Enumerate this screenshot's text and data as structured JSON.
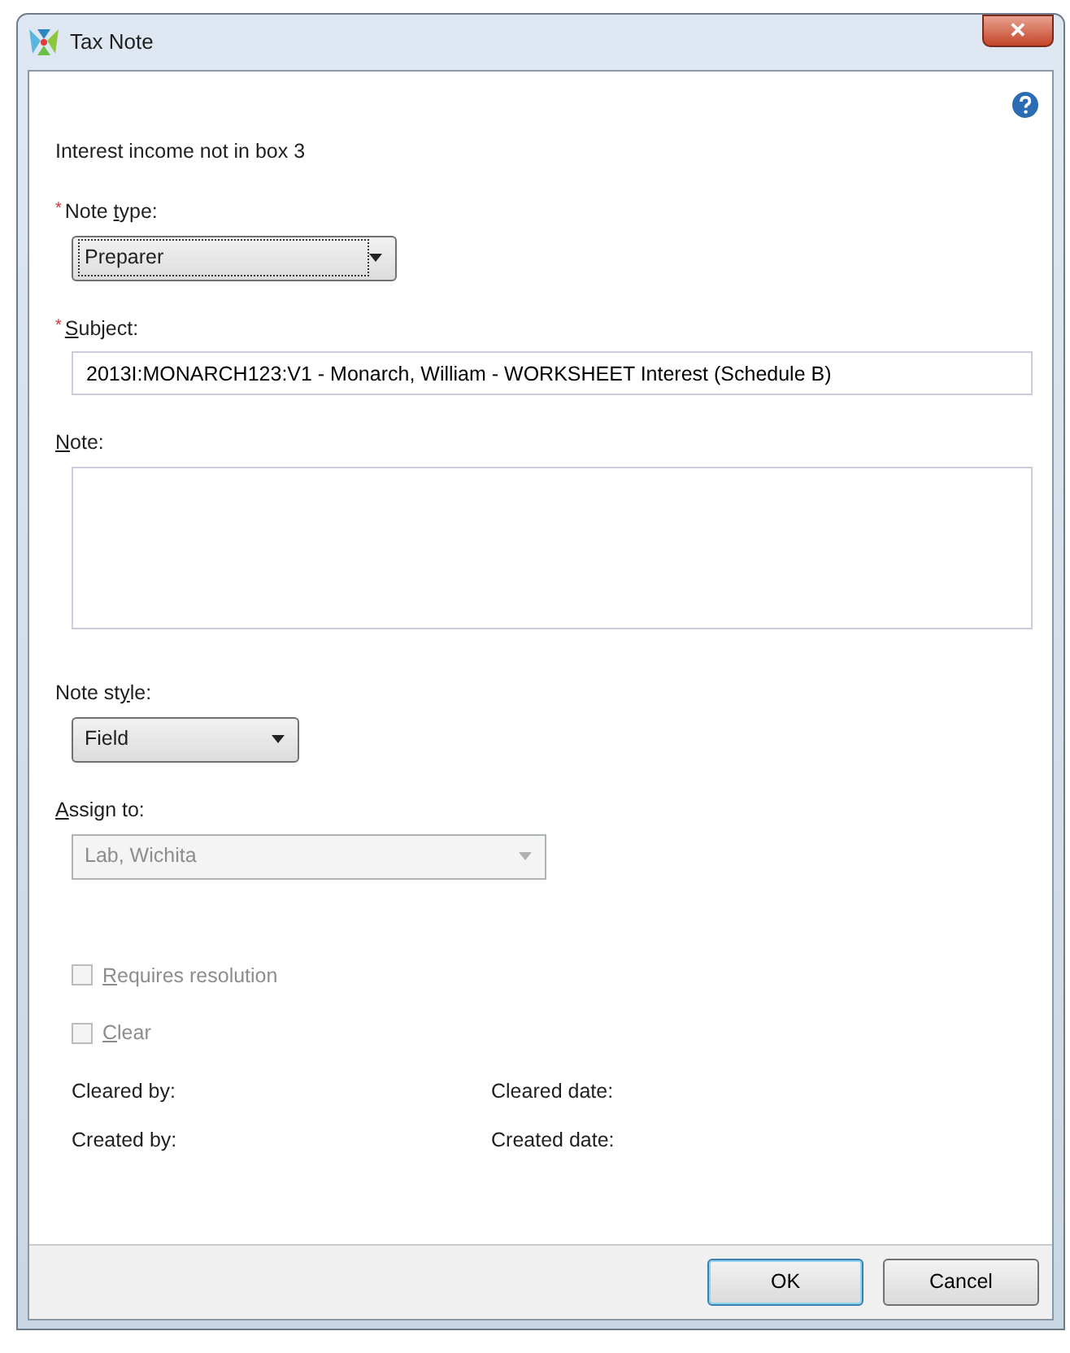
{
  "window": {
    "title": "Tax Note",
    "close_glyph": "✕"
  },
  "heading": "Interest income not in box 3",
  "fields": [
    {
      "kind": "dropdown",
      "required_mark": "*",
      "label": {
        "before": "Note ",
        "key": "t",
        "after": "ype:"
      },
      "value": "Preparer",
      "disabled": false,
      "focused": true
    },
    {
      "kind": "text",
      "required_mark": "*",
      "label": {
        "key": "S",
        "after": "ubject:"
      },
      "value": "2013I:MONARCH123:V1 - Monarch, William - WORKSHEET Interest (Schedule B)",
      "disabled": false,
      "focused": false
    },
    {
      "kind": "textarea",
      "label": {
        "key": "N",
        "after": "ote:"
      },
      "disabled": false,
      "focused": false
    },
    {
      "kind": "dropdown",
      "label": {
        "before": "Note st",
        "key": "y",
        "after": "le:"
      },
      "value": "Field",
      "disabled": false,
      "focused": false
    },
    {
      "kind": "dropdown",
      "label": {
        "key": "A",
        "after": "ssign to:"
      },
      "value": "Lab, Wichita",
      "disabled": true,
      "focused": false
    }
  ],
  "checkboxes": [
    {
      "label": {
        "key": "R",
        "after": "equires resolution"
      },
      "checked": false,
      "disabled": true
    },
    {
      "label": {
        "key": "C",
        "after": "lear"
      },
      "checked": false,
      "disabled": true
    }
  ],
  "info": [
    {
      "left": "Cleared by:",
      "right": "Cleared date:"
    },
    {
      "left": "Created by:",
      "right": "Created date:"
    }
  ],
  "buttons": [
    {
      "label": "OK",
      "default": true
    },
    {
      "label": "Cancel",
      "default": false
    }
  ]
}
